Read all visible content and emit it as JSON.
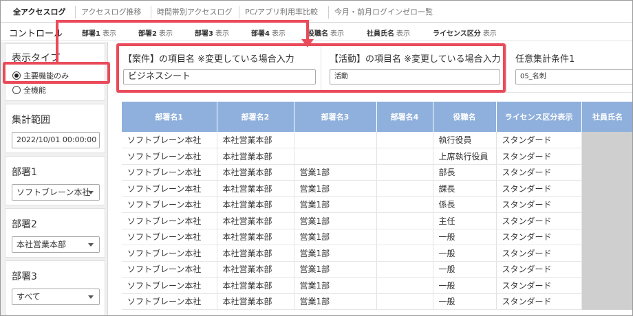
{
  "tabs": [
    {
      "label": "全アクセスログ",
      "active": true
    },
    {
      "label": "アクセスログ推移",
      "active": false
    },
    {
      "label": "時間帯別アクセスログ",
      "active": false
    },
    {
      "label": "PC/アプリ利用率比較",
      "active": false
    },
    {
      "label": "今月・前月ログインゼロ一覧",
      "active": false
    }
  ],
  "column_bar": {
    "label": "コントロール",
    "options": [
      {
        "name": "部署1",
        "state": "表示"
      },
      {
        "name": "部署2",
        "state": "表示"
      },
      {
        "name": "部署3",
        "state": "表示"
      },
      {
        "name": "部署4",
        "state": "表示"
      },
      {
        "name": "役職名",
        "state": "表示"
      },
      {
        "name": "社員氏名",
        "state": "表示"
      },
      {
        "name": "ライセンス区分",
        "state": "表示"
      }
    ]
  },
  "sidebar": {
    "display_type": {
      "title": "表示タイプ",
      "options": [
        "主要機能のみ",
        "全機能"
      ],
      "selected": "主要機能のみ"
    },
    "range": {
      "title": "集計範囲",
      "value": "2022/10/01 00:00:00"
    },
    "dept1": {
      "title": "部署1",
      "value": "ソフトブレーン本社"
    },
    "dept2": {
      "title": "部署2",
      "value": "本社営業本部"
    },
    "dept3": {
      "title": "部署3",
      "value": "すべて"
    }
  },
  "conditions": [
    {
      "title": "【案件】の項目名 ※変更している場合入力",
      "value": "ビジネスシート"
    },
    {
      "title": "【活動】の項目名 ※変更している場合入力",
      "value": "活動"
    },
    {
      "title": "任意集計条件1",
      "value": "05_名刺"
    }
  ],
  "table": {
    "headers": [
      "部署名1",
      "部署名2",
      "部署名3",
      "部署名4",
      "役職名",
      "ライセンス区分表示",
      "社員氏名"
    ],
    "rows": [
      [
        "ソフトブレーン本社",
        "本社営業本部",
        "",
        "",
        "執行役員",
        "スタンダード"
      ],
      [
        "ソフトブレーン本社",
        "本社営業本部",
        "",
        "",
        "上席執行役員",
        "スタンダード"
      ],
      [
        "ソフトブレーン本社",
        "本社営業本部",
        "営業1部",
        "",
        "部長",
        "スタンダード"
      ],
      [
        "ソフトブレーン本社",
        "本社営業本部",
        "営業1部",
        "",
        "課長",
        "スタンダード"
      ],
      [
        "ソフトブレーン本社",
        "本社営業本部",
        "営業1部",
        "",
        "係長",
        "スタンダード"
      ],
      [
        "ソフトブレーン本社",
        "本社営業本部",
        "営業1部",
        "",
        "主任",
        "スタンダード"
      ],
      [
        "ソフトブレーン本社",
        "本社営業本部",
        "営業1部",
        "",
        "一般",
        "スタンダード"
      ],
      [
        "ソフトブレーン本社",
        "本社営業本部",
        "営業1部",
        "",
        "一般",
        "スタンダード"
      ],
      [
        "ソフトブレーン本社",
        "本社営業本部",
        "営業1部",
        "",
        "一般",
        "スタンダード"
      ],
      [
        "ソフトブレーン本社",
        "本社営業本部",
        "営業1部",
        "",
        "一般",
        "スタンダード"
      ],
      [
        "ソフトブレーン本社",
        "本社営業本部",
        "営業1部",
        "",
        "一般",
        "スタンダード"
      ]
    ]
  },
  "colors": {
    "highlight": "#e94b5a",
    "table_header": "#8fb0dc"
  },
  "icons": [
    "radio-selected-icon",
    "radio-icon",
    "chevron-down-icon",
    "arrow-down-icon"
  ]
}
